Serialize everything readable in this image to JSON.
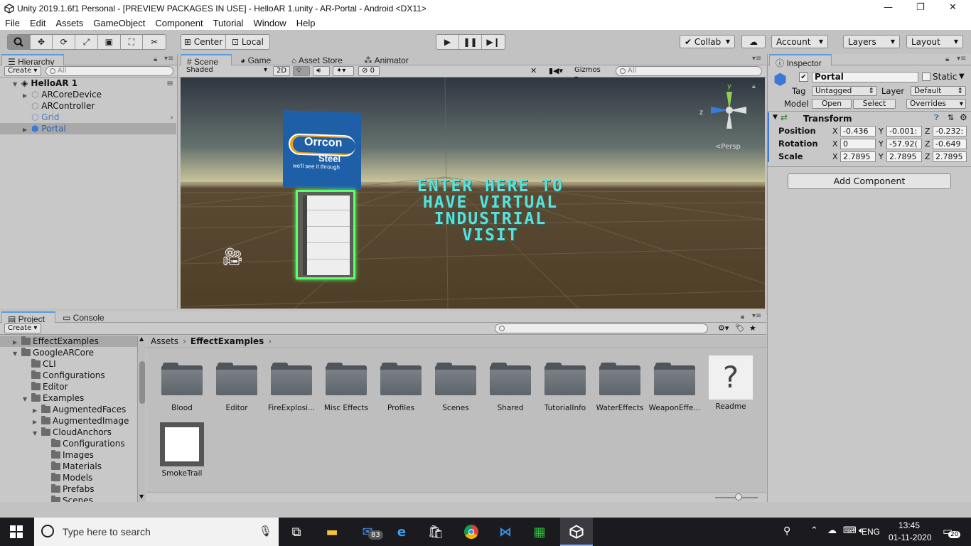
{
  "window": {
    "title": "Unity 2019.1.6f1 Personal - [PREVIEW PACKAGES IN USE] - HelloAR 1.unity - AR-Portal - Android <DX11>"
  },
  "menu": [
    "File",
    "Edit",
    "Assets",
    "GameObject",
    "Component",
    "Tutorial",
    "Window",
    "Help"
  ],
  "toolbar": {
    "pivot": "Center",
    "space": "Local",
    "collab": "Collab",
    "account": "Account",
    "layers": "Layers",
    "layout": "Layout"
  },
  "hierarchy": {
    "tab": "Hierarchy",
    "create": "Create",
    "search_placeholder": "All",
    "scene": "HelloAR 1",
    "items": [
      "ARCoreDevice",
      "ARController",
      "Grid",
      "Portal"
    ]
  },
  "scene_view": {
    "tabs": [
      "Scene",
      "Game",
      "Asset Store",
      "Animator"
    ],
    "shading": "Shaded",
    "mode_2d": "2D",
    "fx_count": "0",
    "gizmos": "Gizmos",
    "search_placeholder": "All",
    "persp": "Persp",
    "overlay_text": [
      "ENTER HERE TO",
      "HAVE VIRTUAL",
      "INDUSTRIAL",
      "VISIT"
    ],
    "sign": {
      "brand": "Orrcon",
      "brand2": "Steel",
      "tagline": "we'll see it through"
    },
    "axes": {
      "y": "y",
      "z": "z"
    }
  },
  "inspector": {
    "tab": "Inspector",
    "name": "Portal",
    "static_label": "Static",
    "tag_label": "Tag",
    "tag": "Untagged",
    "layer_label": "Layer",
    "layer": "Default",
    "model_label": "Model",
    "model_buttons": [
      "Open",
      "Select",
      "Overrides"
    ],
    "component": "Transform",
    "position": {
      "label": "Position",
      "x": "-0.436",
      "y": "-0.001:",
      "z": "-0.232:"
    },
    "rotation": {
      "label": "Rotation",
      "x": "0",
      "y": "-57.92(",
      "z": "-0.649"
    },
    "scale": {
      "label": "Scale",
      "x": "2.7895",
      "y": "2.7895",
      "z": "2.7895"
    },
    "add_component": "Add Component"
  },
  "project": {
    "tabs": [
      "Project",
      "Console"
    ],
    "create": "Create",
    "breadcrumb": [
      "Assets",
      "EffectExamples"
    ],
    "tree": [
      {
        "label": "EffectExamples",
        "depth": 0,
        "arrow": "▶",
        "selected": true
      },
      {
        "label": "GoogleARCore",
        "depth": 0,
        "arrow": "▼"
      },
      {
        "label": "CLI",
        "depth": 1,
        "arrow": ""
      },
      {
        "label": "Configurations",
        "depth": 1,
        "arrow": ""
      },
      {
        "label": "Editor",
        "depth": 1,
        "arrow": ""
      },
      {
        "label": "Examples",
        "depth": 1,
        "arrow": "▼"
      },
      {
        "label": "AugmentedFaces",
        "depth": 2,
        "arrow": "▶"
      },
      {
        "label": "AugmentedImage",
        "depth": 2,
        "arrow": "▶"
      },
      {
        "label": "CloudAnchors",
        "depth": 2,
        "arrow": "▼"
      },
      {
        "label": "Configurations",
        "depth": 3,
        "arrow": ""
      },
      {
        "label": "Images",
        "depth": 3,
        "arrow": ""
      },
      {
        "label": "Materials",
        "depth": 3,
        "arrow": ""
      },
      {
        "label": "Models",
        "depth": 3,
        "arrow": ""
      },
      {
        "label": "Prefabs",
        "depth": 3,
        "arrow": ""
      },
      {
        "label": "Scenes",
        "depth": 3,
        "arrow": ""
      }
    ],
    "assets": [
      "Blood",
      "Editor",
      "FireExplosi...",
      "Misc Effects",
      "Profiles",
      "Scenes",
      "Shared",
      "TutorialInfo",
      "WaterEffects",
      "WeaponEffe...",
      "Readme",
      "SmokeTrail"
    ]
  },
  "taskbar": {
    "search_placeholder": "Type here to search",
    "mail_badge": "83",
    "lang": "ENG",
    "time": "13:45",
    "date": "01-11-2020",
    "notif": "20"
  }
}
